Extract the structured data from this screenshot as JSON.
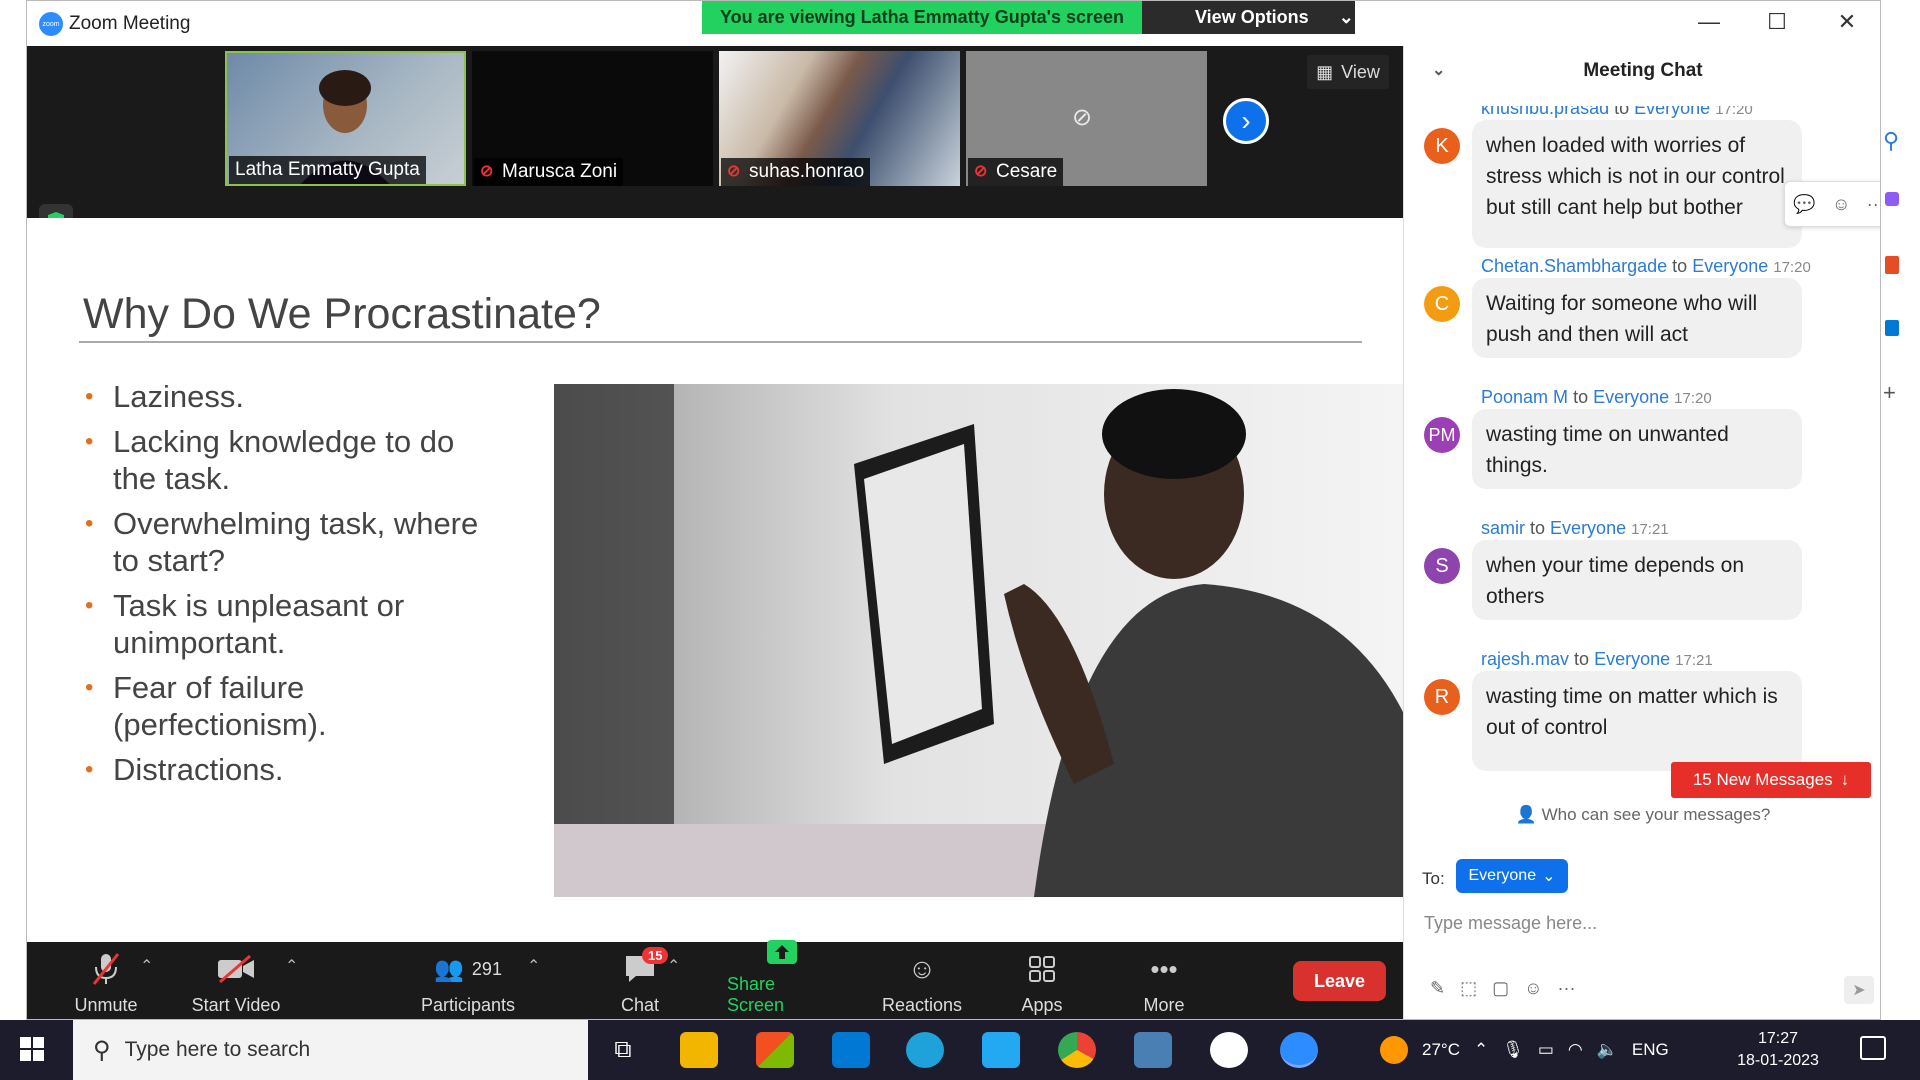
{
  "window": {
    "title": "Zoom Meeting",
    "logo_text": "zoom"
  },
  "share_banner": {
    "text": "You are viewing Latha Emmatty Gupta's screen",
    "view_options": "View Options"
  },
  "video_strip": {
    "view_label": "View",
    "tiles": [
      {
        "name": "Latha Emmatty Gupta"
      },
      {
        "name": "Marusca Zoni"
      },
      {
        "name": "suhas.honrao"
      },
      {
        "name": "Cesare"
      }
    ]
  },
  "slide": {
    "title": "Why Do We Procrastinate?",
    "bullets": [
      "Laziness.",
      "Lacking knowledge to do the task.",
      "Overwhelming task, where to start?",
      "Task is unpleasant or unimportant.",
      "Fear of failure (perfectionism).",
      "Distractions."
    ]
  },
  "toolbar": {
    "unmute": "Unmute",
    "start_video": "Start Video",
    "participants": "Participants",
    "participants_count": "291",
    "chat": "Chat",
    "chat_badge": "15",
    "share_screen": "Share Screen",
    "reactions": "Reactions",
    "apps": "Apps",
    "more": "More",
    "leave": "Leave"
  },
  "chat": {
    "title": "Meeting Chat",
    "to_word": "to",
    "messages": [
      {
        "sender": "khushbu.prasad",
        "recipient": "Everyone",
        "time": "17:20",
        "initial": "K",
        "color": "#e8601c",
        "text": "when loaded with worries of stress which is not in our control but still cant help but bother"
      },
      {
        "sender": "Chetan.Shambhargade",
        "recipient": "Everyone",
        "time": "17:20",
        "initial": "C",
        "color": "#f39c12",
        "text": "Waiting for someone who will push and then will act"
      },
      {
        "sender": "Poonam M",
        "recipient": "Everyone",
        "time": "17:20",
        "initial": "PM",
        "color": "#9b3fb5",
        "text": "wasting  time on unwanted things."
      },
      {
        "sender": "samir",
        "recipient": "Everyone",
        "time": "17:21",
        "initial": "S",
        "color": "#8e44ad",
        "text": "when your time depends on others"
      },
      {
        "sender": "rajesh.mav",
        "recipient": "Everyone",
        "time": "17:21",
        "initial": "R",
        "color": "#e8601c",
        "text": "wasting time on matter which is out of control"
      }
    ],
    "new_messages": "15 New Messages",
    "who_can_see": "Who can see your messages?",
    "to_label": "To:",
    "recipient_select": "Everyone",
    "input_placeholder": "Type message here..."
  },
  "taskbar": {
    "search_placeholder": "Type here to search",
    "weather": "27°C",
    "language": "ENG",
    "time": "17:27",
    "date": "18-01-2023"
  }
}
